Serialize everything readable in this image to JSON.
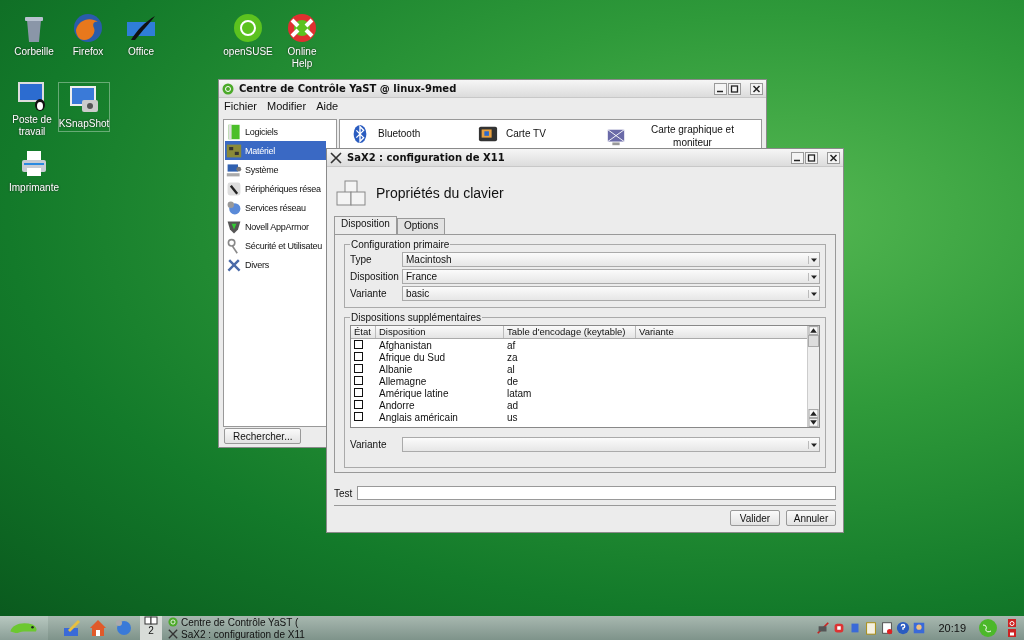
{
  "desktop": {
    "icons": [
      {
        "label": "Corbeille",
        "kind": "trash",
        "selected": false
      },
      {
        "label": "Firefox",
        "kind": "browser",
        "selected": false
      },
      {
        "label": "Office",
        "kind": "office",
        "selected": false
      },
      {
        "label": "openSUSE",
        "kind": "suse",
        "selected": false
      },
      {
        "label": "Online Help",
        "kind": "help",
        "selected": false
      },
      {
        "label": "Poste de travail",
        "kind": "computer",
        "selected": false
      },
      {
        "label": "KSnapShot",
        "kind": "snapshot",
        "selected": true
      },
      {
        "label": "Imprimante",
        "kind": "printer",
        "selected": false
      }
    ]
  },
  "yast": {
    "title": "Centre de Contrôle YaST @ linux-9med",
    "menu": [
      "Fichier",
      "Modifier",
      "Aide"
    ],
    "categories": [
      {
        "label": "Logiciels",
        "kind": "software",
        "selected": false
      },
      {
        "label": "Matériel",
        "kind": "hardware",
        "selected": true
      },
      {
        "label": "Système",
        "kind": "system",
        "selected": false
      },
      {
        "label": "Périphériques résea",
        "kind": "network",
        "selected": false
      },
      {
        "label": "Services réseau",
        "kind": "services",
        "selected": false
      },
      {
        "label": "Novell AppArmor",
        "kind": "armor",
        "selected": false
      },
      {
        "label": "Sécurité et Utilisateu",
        "kind": "users",
        "selected": false
      },
      {
        "label": "Divers",
        "kind": "tools",
        "selected": false
      }
    ],
    "modules": [
      {
        "label": "Bluetooth",
        "kind": "bluetooth"
      },
      {
        "label": "Carte TV",
        "kind": "tv"
      },
      {
        "label": "Carte graphique et moniteur",
        "kind": "monitor"
      }
    ],
    "search_button": "Rechercher..."
  },
  "sax2": {
    "title": "SaX2 : configuration de X11",
    "heading": "Propriétés du clavier",
    "tabs": [
      {
        "label": "Disposition",
        "selected": true
      },
      {
        "label": "Options",
        "selected": false
      }
    ],
    "primary": {
      "title": "Configuration primaire",
      "fields": [
        {
          "label": "Type",
          "value": "Macintosh"
        },
        {
          "label": "Disposition",
          "value": "France"
        },
        {
          "label": "Variante",
          "value": "basic"
        }
      ]
    },
    "extra": {
      "title": "Dispositions supplémentaires",
      "columns": [
        "État",
        "Disposition",
        "Table d'encodage (keytable)",
        "Variante"
      ],
      "rows": [
        {
          "checked": false,
          "disposition": "Afghanistan",
          "keytable": "af"
        },
        {
          "checked": false,
          "disposition": "Afrique du Sud",
          "keytable": "za"
        },
        {
          "checked": false,
          "disposition": "Albanie",
          "keytable": "al"
        },
        {
          "checked": false,
          "disposition": "Allemagne",
          "keytable": "de"
        },
        {
          "checked": false,
          "disposition": "Amérique latine",
          "keytable": "latam"
        },
        {
          "checked": false,
          "disposition": "Andorre",
          "keytable": "ad"
        },
        {
          "checked": false,
          "disposition": "Anglais américain",
          "keytable": "us"
        }
      ],
      "variant_label": "Variante"
    },
    "test_label": "Test",
    "buttons": [
      "Valider",
      "Annuler"
    ]
  },
  "taskbar": {
    "pager": "2",
    "tasks": [
      {
        "title": "Centre de Contrôle YaST (",
        "kind": "yast"
      },
      {
        "title": "SaX2 : configuration de X11",
        "kind": "x11"
      }
    ],
    "clock": "20:19"
  }
}
